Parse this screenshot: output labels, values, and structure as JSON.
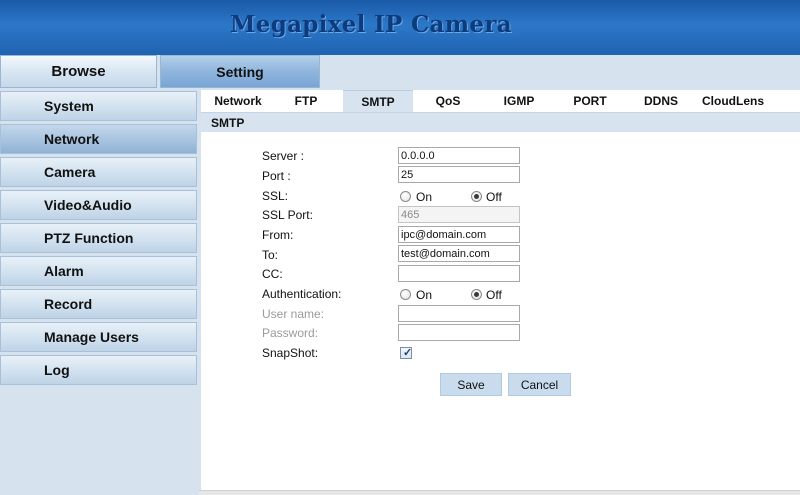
{
  "header": {
    "title": "Megapixel IP Camera"
  },
  "top_tabs": [
    {
      "label": "Browse",
      "active": false
    },
    {
      "label": "Setting",
      "active": true
    }
  ],
  "sidebar": {
    "items": [
      {
        "label": "System"
      },
      {
        "label": "Network",
        "active": true
      },
      {
        "label": "Camera"
      },
      {
        "label": "Video&Audio"
      },
      {
        "label": "PTZ Function"
      },
      {
        "label": "Alarm"
      },
      {
        "label": "Record"
      },
      {
        "label": "Manage Users"
      },
      {
        "label": "Log"
      }
    ]
  },
  "subtabs": [
    {
      "label": "Network"
    },
    {
      "label": "FTP"
    },
    {
      "label": "SMTP",
      "active": true
    },
    {
      "label": "QoS"
    },
    {
      "label": "IGMP"
    },
    {
      "label": "PORT"
    },
    {
      "label": "DDNS"
    },
    {
      "label": "CloudLens"
    }
  ],
  "section": {
    "title": "SMTP"
  },
  "form": {
    "server": {
      "label": "Server :",
      "value": "0.0.0.0"
    },
    "port": {
      "label": "Port :",
      "value": "25"
    },
    "ssl": {
      "label": "SSL:",
      "on_label": "On",
      "off_label": "Off",
      "selected": "Off"
    },
    "ssl_port": {
      "label": "SSL Port:",
      "value": "465"
    },
    "from": {
      "label": "From:",
      "value": "ipc@domain.com"
    },
    "to": {
      "label": "To:",
      "value": "test@domain.com"
    },
    "cc": {
      "label": "CC:",
      "value": ""
    },
    "authentication": {
      "label": "Authentication:",
      "on_label": "On",
      "off_label": "Off",
      "selected": "Off"
    },
    "user_name": {
      "label": "User name:",
      "value": ""
    },
    "password": {
      "label": "Password:",
      "value": ""
    },
    "snapshot": {
      "label": "SnapShot:",
      "checked": true
    }
  },
  "buttons": {
    "save": "Save",
    "cancel": "Cancel"
  },
  "colors": {
    "header_blue": "#2c78c8",
    "title_navy": "#0d3c7e",
    "panel_bg": "#d6e3ef",
    "section_bar": "#d7e4f0",
    "button_bg": "#c9dcee"
  }
}
